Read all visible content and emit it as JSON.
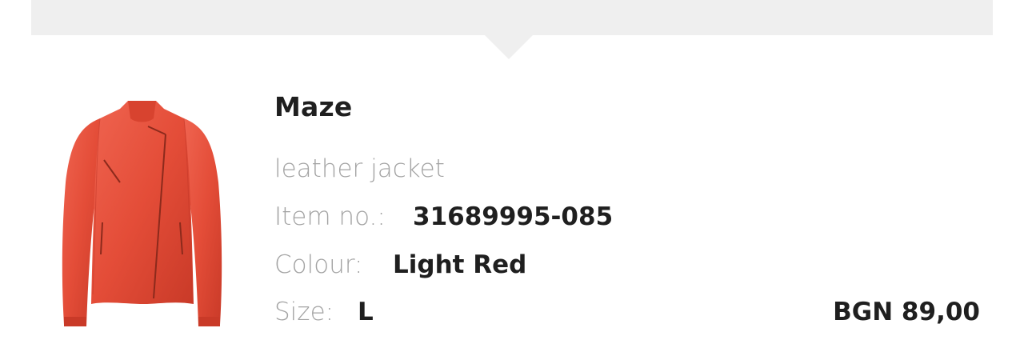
{
  "product": {
    "brand": "Maze",
    "description": "leather jacket",
    "item_no_label": "Item no.:",
    "item_no": "31689995-085",
    "colour_label": "Colour:",
    "colour": "Light Red",
    "size_label": "Size:",
    "size": "L",
    "price": "BGN 89,00",
    "image_icon": "leather-jacket-image",
    "colors": {
      "jacket": "#e8503a",
      "banner": "#efefef"
    }
  }
}
